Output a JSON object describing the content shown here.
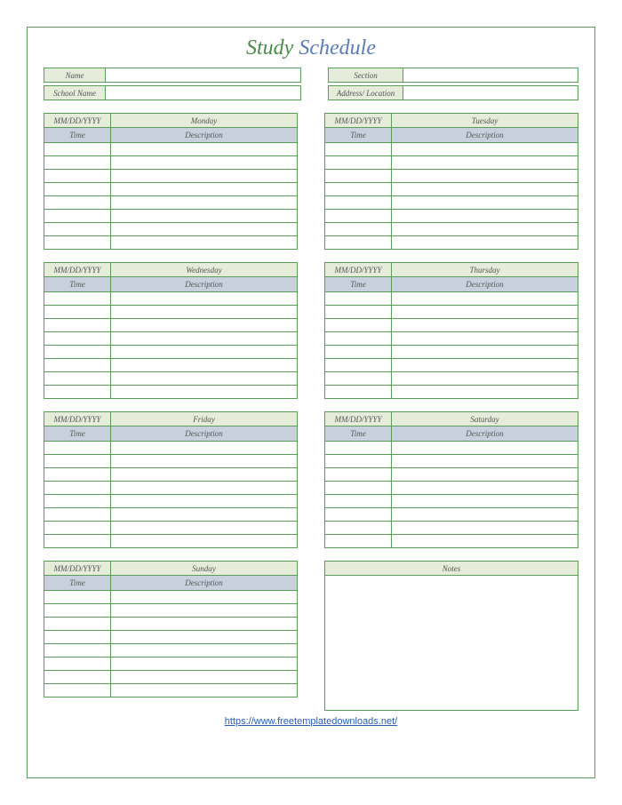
{
  "title_part1": "Study ",
  "title_part2": "Schedule",
  "info": {
    "name_label": "Name",
    "school_label": "School Name",
    "section_label": "Section",
    "address_label": "Address/ Location"
  },
  "date_format": "MM/DD/YYYY",
  "col_time": "Time",
  "col_desc": "Description",
  "days": {
    "d0": "Monday",
    "d1": "Tuesday",
    "d2": "Wednesday",
    "d3": "Thursday",
    "d4": "Friday",
    "d5": "Saturday",
    "d6": "Sunday"
  },
  "notes_label": "Notes",
  "footer_url": "https://www.freetemplatedownloads.net/"
}
